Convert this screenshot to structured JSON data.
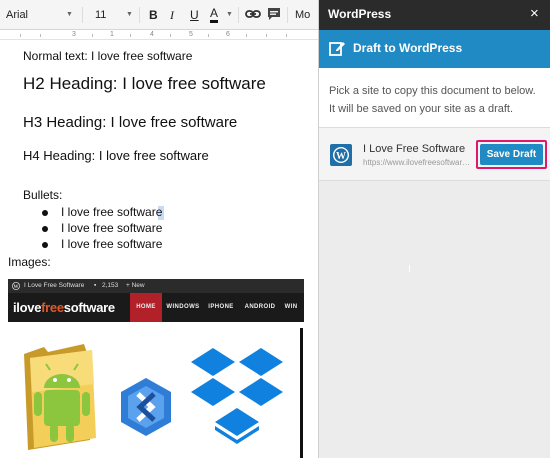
{
  "toolbar": {
    "font_family": "Arial",
    "font_size": "11",
    "bold": "B",
    "italic": "I",
    "underline": "U",
    "text_color": "A",
    "more": "Mo"
  },
  "ruler": {
    "marks": [
      "3",
      "1",
      "4",
      "5",
      "6"
    ]
  },
  "document": {
    "normal_text": "Normal text: I love free software",
    "h2": "H2 Heading: I love free software",
    "h3": "H3 Heading: I love free software",
    "h4": "H4 Heading: I love free software",
    "bullets_label": "Bullets:",
    "bullets": [
      "I love free software",
      "I love free software",
      "I love free software"
    ],
    "images_label": "Images:"
  },
  "embedded_site": {
    "admin_bar": {
      "site": "I Love Free Software",
      "comments": "2,153",
      "new": "+ New"
    },
    "logo_plain": "ilove",
    "logo_accent": "free",
    "logo_tail": "software",
    "nav": [
      "HOME",
      "WINDOWS",
      "IPHONE",
      "ANDROID",
      "WIN"
    ],
    "accent_color": "#b2202a"
  },
  "sidebar": {
    "title": "WordPress",
    "close": "×",
    "header": "Draft to WordPress",
    "info": "Pick a site to copy this document to below. It will be saved on your site as a draft.",
    "site_name": "I Love Free Software",
    "site_url": "https://www.ilovefreesoftware.com",
    "save_button": "Save Draft",
    "brand_color": "#1f8ac4",
    "highlight_color": "#e0186c"
  }
}
